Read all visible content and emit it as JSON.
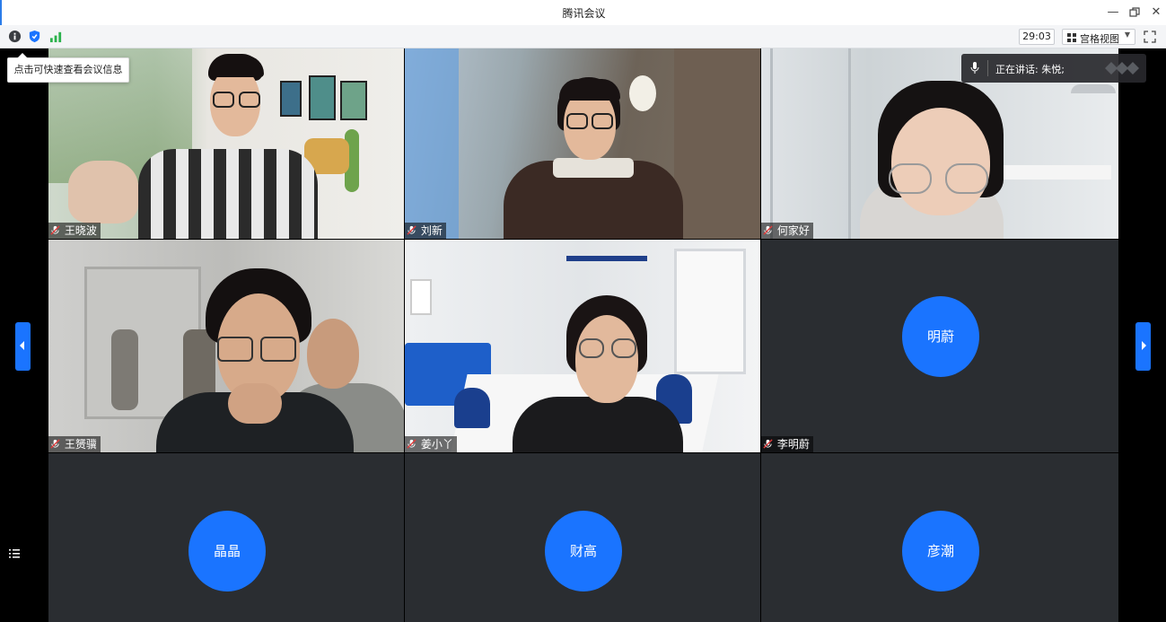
{
  "window": {
    "title": "腾讯会议"
  },
  "toolbar": {
    "timer": "29:03",
    "view_label": "宫格视图",
    "tooltip": "点击可快速查看会议信息"
  },
  "speaking": {
    "text": "正在讲话: 朱悦;"
  },
  "participants": [
    {
      "name": "王晓波",
      "video": true
    },
    {
      "name": "刘新",
      "video": true
    },
    {
      "name": "何家好",
      "video": true
    },
    {
      "name": "王赟骥",
      "video": true
    },
    {
      "name": "姜小丫",
      "video": true
    },
    {
      "name": "李明蔚",
      "video": false,
      "avatar": "明蔚"
    },
    {
      "name": "",
      "video": false,
      "avatar": "晶晶"
    },
    {
      "name": "",
      "video": false,
      "avatar": "财高"
    },
    {
      "name": "",
      "video": false,
      "avatar": "彦潮"
    }
  ],
  "colors": {
    "accent": "#1a74ff",
    "tile_bg": "#2a2d31",
    "signal": "#2bb24c"
  }
}
